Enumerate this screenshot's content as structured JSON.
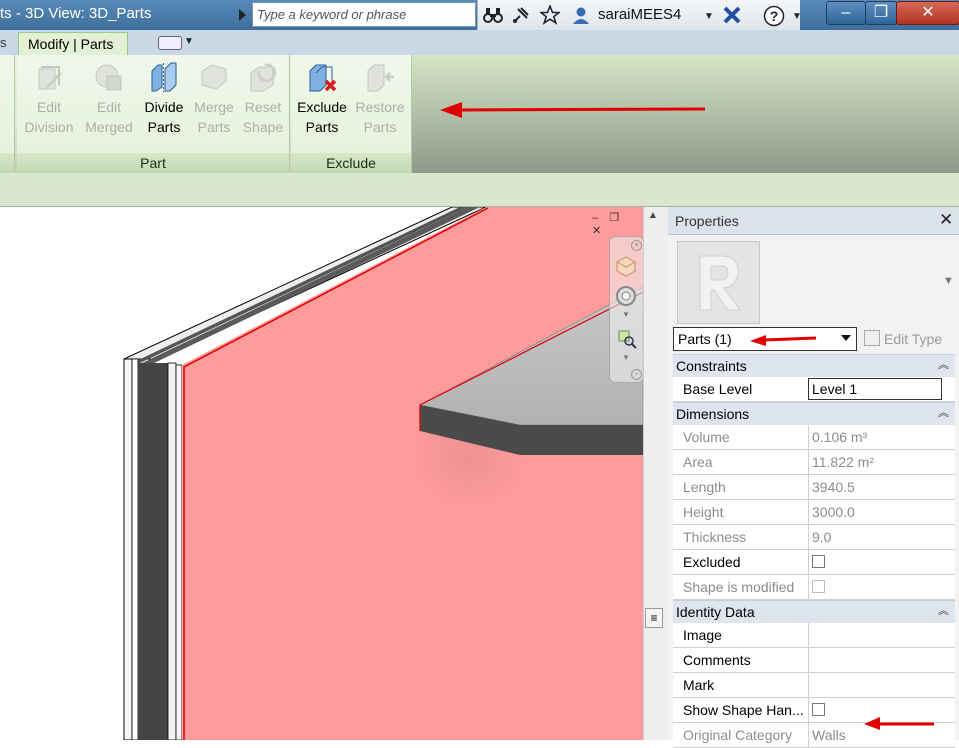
{
  "window": {
    "title": "ts - 3D View: 3D_Parts",
    "search_placeholder": "Type a keyword or phrase",
    "user": "saraiMEES4",
    "icons": [
      "binoculars-icon",
      "satellite-icon",
      "star-icon",
      "user-icon",
      "exchange-x-icon",
      "help-icon"
    ],
    "buttons": {
      "minimize": "–",
      "restore": "❐",
      "close": "✕"
    }
  },
  "tabs": {
    "prev_tab": "s",
    "active": "Modify | Parts"
  },
  "ribbon": {
    "panels": [
      {
        "label": "Part",
        "buttons": [
          {
            "line1": "Edit",
            "line2": "Division",
            "enabled": false
          },
          {
            "line1": "Edit",
            "line2": "Merged",
            "enabled": false
          },
          {
            "line1": "Divide",
            "line2": "Parts",
            "enabled": true
          },
          {
            "line1": "Merge",
            "line2": "Parts",
            "enabled": false
          },
          {
            "line1": "Reset",
            "line2": "Shape",
            "enabled": false
          }
        ]
      },
      {
        "label": "Exclude",
        "buttons": [
          {
            "line1": "Exclude",
            "line2": "Parts",
            "enabled": true
          },
          {
            "line1": "Restore",
            "line2": "Parts",
            "enabled": false
          }
        ]
      }
    ]
  },
  "viewport": {
    "window_controls": [
      "–",
      "❐",
      "✕"
    ]
  },
  "properties": {
    "title": "Properties",
    "close": "✕",
    "type_selector": "Parts (1)",
    "edit_type": "Edit Type",
    "groups": [
      {
        "name": "Constraints",
        "rows": [
          {
            "label": "Base Level",
            "value": "Level 1",
            "kind": "edit"
          }
        ]
      },
      {
        "name": "Dimensions",
        "rows": [
          {
            "label": "Volume",
            "value": "0.106 m³",
            "kind": "readonly"
          },
          {
            "label": "Area",
            "value": "11.822 m²",
            "kind": "readonly"
          },
          {
            "label": "Length",
            "value": "3940.5",
            "kind": "readonly"
          },
          {
            "label": "Height",
            "value": "3000.0",
            "kind": "readonly"
          },
          {
            "label": "Thickness",
            "value": "9.0",
            "kind": "readonly"
          },
          {
            "label": "Excluded",
            "value": "",
            "kind": "checkbox",
            "checked": false
          },
          {
            "label": "Shape is modified",
            "value": "",
            "kind": "checkbox-readonly",
            "checked": false
          }
        ]
      },
      {
        "name": "Identity Data",
        "rows": [
          {
            "label": "Image",
            "value": "",
            "kind": "text"
          },
          {
            "label": "Comments",
            "value": "",
            "kind": "text"
          },
          {
            "label": "Mark",
            "value": "",
            "kind": "text"
          },
          {
            "label": "Show Shape Han...",
            "value": "",
            "kind": "checkbox",
            "checked": false
          },
          {
            "label": "Original Category",
            "value": "Walls",
            "kind": "readonly"
          }
        ]
      }
    ]
  },
  "annotation_color": "#e00000"
}
